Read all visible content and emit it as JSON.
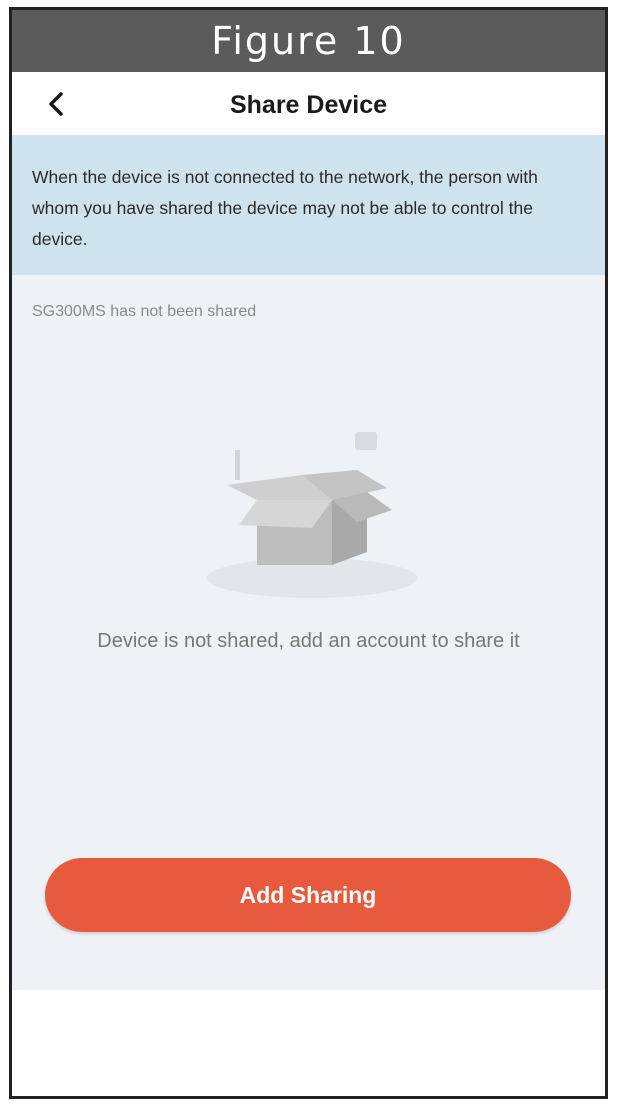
{
  "figure_caption": "Figure 10",
  "header": {
    "title": "Share Device",
    "back_icon": "chevron-left-icon"
  },
  "notice": {
    "text": "When the device is not connected to the network, the person with whom you have shared the device may not be able to control the device."
  },
  "main": {
    "status_text": "SG300MS has not been shared",
    "empty_icon": "empty-box-icon",
    "empty_message": "Device is not shared, add an account to share it",
    "add_button_label": "Add Sharing"
  },
  "colors": {
    "accent": "#e85a3e",
    "notice_bg": "#cfe3ee",
    "content_bg": "#eef1f5",
    "banner_bg": "#5b5b5b"
  }
}
